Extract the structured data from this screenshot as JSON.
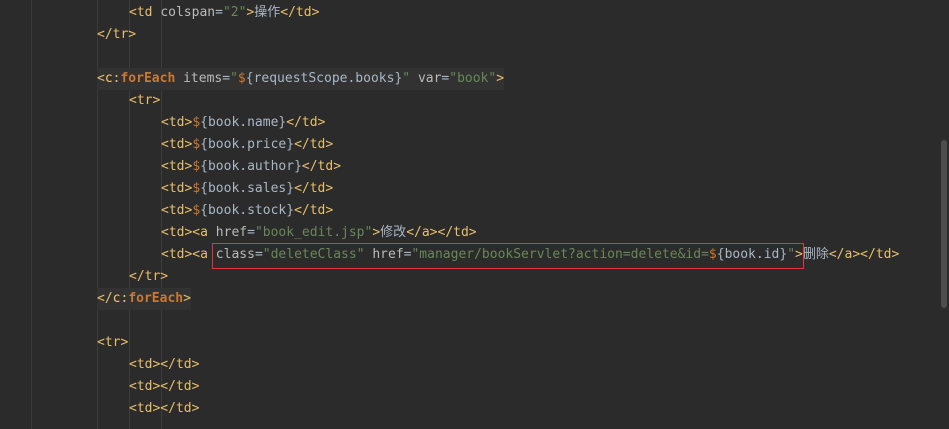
{
  "editor": {
    "lines": [
      {
        "parts": [
          {
            "c": "tag",
            "t": "<td "
          },
          {
            "c": "attr",
            "t": "colspan"
          },
          {
            "c": "txt",
            "t": "="
          },
          {
            "c": "str",
            "t": "\"2\""
          },
          {
            "c": "tag",
            "t": ">"
          },
          {
            "c": "txt",
            "t": "操作"
          },
          {
            "c": "tag",
            "t": "</td>"
          }
        ]
      },
      {
        "parts": [
          {
            "c": "tag",
            "t": "</tr>"
          }
        ]
      },
      {
        "parts": []
      },
      {
        "parts": [
          {
            "c": "tag",
            "t": "<"
          },
          {
            "c": "cns",
            "t": "c"
          },
          {
            "c": "tag",
            "t": ":"
          },
          {
            "c": "cfor",
            "t": "forEach"
          },
          {
            "c": "tag",
            "t": " "
          },
          {
            "c": "attr",
            "t": "items"
          },
          {
            "c": "txt",
            "t": "="
          },
          {
            "c": "str",
            "t": "\""
          },
          {
            "c": "dollar",
            "t": "$"
          },
          {
            "c": "brace",
            "t": "{"
          },
          {
            "c": "el",
            "t": "requestScope.books"
          },
          {
            "c": "brace",
            "t": "}"
          },
          {
            "c": "str",
            "t": "\""
          },
          {
            "c": "tag",
            "t": " "
          },
          {
            "c": "attr",
            "t": "var"
          },
          {
            "c": "txt",
            "t": "="
          },
          {
            "c": "str",
            "t": "\"book\""
          },
          {
            "c": "tag",
            "t": ">"
          }
        ]
      },
      {
        "parts": [
          {
            "c": "tag",
            "t": "<tr>"
          }
        ]
      },
      {
        "parts": [
          {
            "c": "tag",
            "t": "<td>"
          },
          {
            "c": "dollar",
            "t": "$"
          },
          {
            "c": "brace",
            "t": "{"
          },
          {
            "c": "el",
            "t": "book.name"
          },
          {
            "c": "brace",
            "t": "}"
          },
          {
            "c": "tag",
            "t": "</td>"
          }
        ]
      },
      {
        "parts": [
          {
            "c": "tag",
            "t": "<td>"
          },
          {
            "c": "dollar",
            "t": "$"
          },
          {
            "c": "brace",
            "t": "{"
          },
          {
            "c": "el",
            "t": "book.price"
          },
          {
            "c": "brace",
            "t": "}"
          },
          {
            "c": "tag",
            "t": "</td>"
          }
        ]
      },
      {
        "parts": [
          {
            "c": "tag",
            "t": "<td>"
          },
          {
            "c": "dollar",
            "t": "$"
          },
          {
            "c": "brace",
            "t": "{"
          },
          {
            "c": "el",
            "t": "book.author"
          },
          {
            "c": "brace",
            "t": "}"
          },
          {
            "c": "tag",
            "t": "</td>"
          }
        ]
      },
      {
        "parts": [
          {
            "c": "tag",
            "t": "<td>"
          },
          {
            "c": "dollar",
            "t": "$"
          },
          {
            "c": "brace",
            "t": "{"
          },
          {
            "c": "el",
            "t": "book.sales"
          },
          {
            "c": "brace",
            "t": "}"
          },
          {
            "c": "tag",
            "t": "</td>"
          }
        ]
      },
      {
        "parts": [
          {
            "c": "tag",
            "t": "<td>"
          },
          {
            "c": "dollar",
            "t": "$"
          },
          {
            "c": "brace",
            "t": "{"
          },
          {
            "c": "el",
            "t": "book.stock"
          },
          {
            "c": "brace",
            "t": "}"
          },
          {
            "c": "tag",
            "t": "</td>"
          }
        ]
      },
      {
        "parts": [
          {
            "c": "tag",
            "t": "<td><a "
          },
          {
            "c": "attr",
            "t": "href"
          },
          {
            "c": "txt",
            "t": "="
          },
          {
            "c": "str",
            "t": "\"book_edit.jsp\""
          },
          {
            "c": "tag",
            "t": ">"
          },
          {
            "c": "txt",
            "t": "修改"
          },
          {
            "c": "tag",
            "t": "</a></td>"
          }
        ]
      },
      {
        "parts": [
          {
            "c": "tag",
            "t": "<td><a "
          },
          {
            "c": "attr",
            "t": "class"
          },
          {
            "c": "txt",
            "t": "="
          },
          {
            "c": "str",
            "t": "\"deleteClass\""
          },
          {
            "c": "tag",
            "t": " "
          },
          {
            "c": "attr",
            "t": "href"
          },
          {
            "c": "txt",
            "t": "="
          },
          {
            "c": "str",
            "t": "\"manager/bookServlet?action=delete&id="
          },
          {
            "c": "dollar",
            "t": "$"
          },
          {
            "c": "brace",
            "t": "{"
          },
          {
            "c": "el",
            "t": "book.id"
          },
          {
            "c": "brace",
            "t": "}"
          },
          {
            "c": "str",
            "t": "\""
          },
          {
            "c": "tag",
            "t": ">"
          },
          {
            "c": "txt",
            "t": "删除"
          },
          {
            "c": "tag",
            "t": "</a></td>"
          }
        ]
      },
      {
        "parts": [
          {
            "c": "tag",
            "t": "</tr>"
          }
        ]
      },
      {
        "parts": [
          {
            "c": "tag",
            "t": "</"
          },
          {
            "c": "cns",
            "t": "c"
          },
          {
            "c": "tag",
            "t": ":"
          },
          {
            "c": "cfor",
            "t": "forEach"
          },
          {
            "c": "tag",
            "t": ">"
          }
        ]
      },
      {
        "parts": []
      },
      {
        "parts": [
          {
            "c": "tag",
            "t": "<tr>"
          }
        ]
      },
      {
        "parts": [
          {
            "c": "tag",
            "t": "<td></td>"
          }
        ]
      },
      {
        "parts": [
          {
            "c": "tag",
            "t": "<td></td>"
          }
        ]
      },
      {
        "parts": [
          {
            "c": "tag",
            "t": "<td></td>"
          }
        ]
      }
    ]
  }
}
